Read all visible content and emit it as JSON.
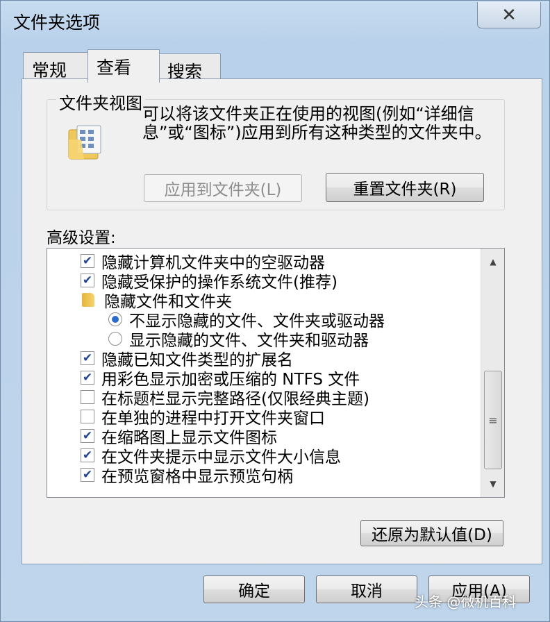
{
  "window": {
    "title": "文件夹选项",
    "close_icon": "close-icon"
  },
  "tabs": [
    {
      "label": "常规",
      "active": false
    },
    {
      "label": "查看",
      "active": true
    },
    {
      "label": "搜索",
      "active": false
    }
  ],
  "folder_views": {
    "group_title": "文件夹视图",
    "description": "可以将该文件夹正在使用的视图(例如“详细信息”或“图标”)应用到所有这种类型的文件夹中。",
    "apply_button": "应用到文件夹(L)",
    "reset_button": "重置文件夹(R)"
  },
  "advanced": {
    "label": "高级设置:",
    "items": [
      {
        "type": "checkbox",
        "checked": true,
        "label": "隐藏计算机文件夹中的空驱动器"
      },
      {
        "type": "checkbox",
        "checked": true,
        "label": "隐藏受保护的操作系统文件(推荐)"
      },
      {
        "type": "folder",
        "label": "隐藏文件和文件夹"
      },
      {
        "type": "radio",
        "checked": true,
        "label": "不显示隐藏的文件、文件夹或驱动器"
      },
      {
        "type": "radio",
        "checked": false,
        "label": "显示隐藏的文件、文件夹和驱动器"
      },
      {
        "type": "checkbox",
        "checked": true,
        "label": "隐藏已知文件类型的扩展名"
      },
      {
        "type": "checkbox",
        "checked": true,
        "label": "用彩色显示加密或压缩的 NTFS 文件"
      },
      {
        "type": "checkbox",
        "checked": false,
        "label": "在标题栏显示完整路径(仅限经典主题)"
      },
      {
        "type": "checkbox",
        "checked": false,
        "label": "在单独的进程中打开文件夹窗口"
      },
      {
        "type": "checkbox",
        "checked": true,
        "label": "在缩略图上显示文件图标"
      },
      {
        "type": "checkbox",
        "checked": true,
        "label": "在文件夹提示中显示文件大小信息"
      },
      {
        "type": "checkbox",
        "checked": true,
        "label": "在预览窗格中显示预览句柄"
      }
    ],
    "restore_button": "还原为默认值(D)"
  },
  "footer": {
    "ok_button": "确定",
    "cancel_button": "取消",
    "apply_button": "应用(A)"
  },
  "watermark": "头条 @微机百科",
  "colors": {
    "check": "#21449e",
    "radio_dot": "#2a6bd2",
    "frame": "#bcd3ea"
  }
}
